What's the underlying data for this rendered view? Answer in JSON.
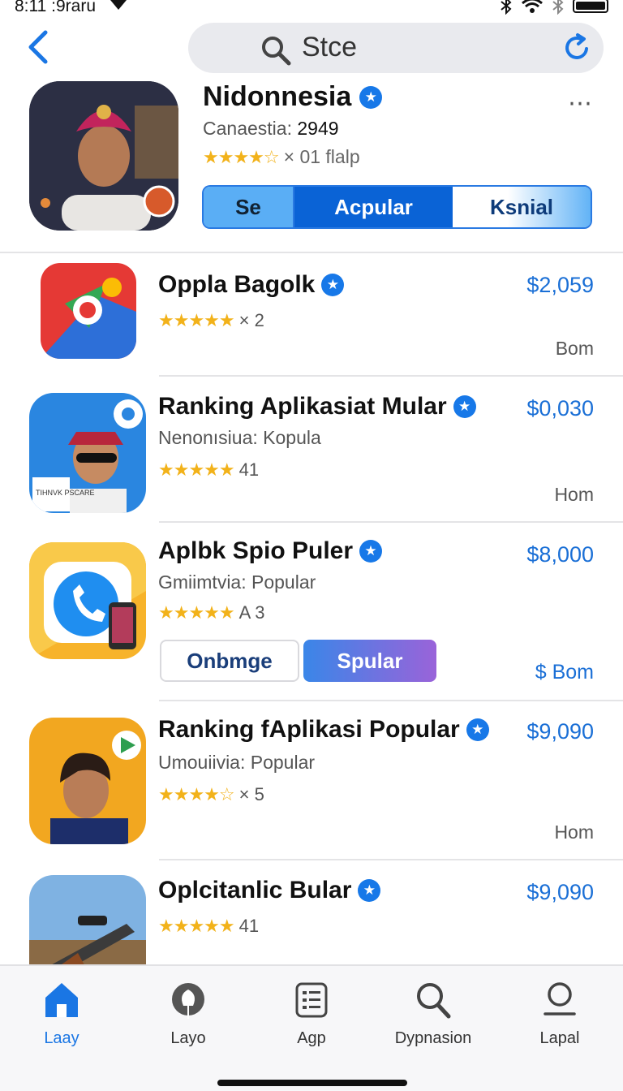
{
  "status": {
    "time": "8:11 :9raru"
  },
  "search": {
    "text": "Stce"
  },
  "featured": {
    "title": "Nidonnesia",
    "subtitle_label": "Canaestia:",
    "subtitle_value": "2949",
    "rating_text": "× 01 flalp",
    "segments": [
      "Se",
      "Acpular",
      "Ksnial"
    ]
  },
  "apps": [
    {
      "name": "Oppla Bagolk",
      "category": "",
      "rating": "× 2",
      "stars": 4.5,
      "price": "$2,059",
      "meta": "Bom"
    },
    {
      "name": "Ranking Aplikasiat Mular",
      "category": "Nenonısiua: Kopula",
      "rating": "41",
      "stars": 4.5,
      "price": "$0,030",
      "meta": "Hom",
      "icon_text": "TIHNVK PSCARE"
    },
    {
      "name": "Aplbk Spio Puler",
      "category": "Gmiimtvia: Popular",
      "rating": "A 3",
      "stars": 5,
      "price": "$8,000",
      "meta": "$ Bom",
      "buttons": [
        "Onbmge",
        "Spular"
      ]
    },
    {
      "name": "Ranking fAplikasi Popular",
      "category": "Umouiivia: Popular",
      "rating": "× 5",
      "stars": 4.5,
      "price": "$9,090",
      "meta": "Hom"
    },
    {
      "name": "Oplcitanlic Bular",
      "category": "",
      "rating": "41",
      "stars": 5,
      "price": "$9,090",
      "meta": ""
    }
  ],
  "tabs": [
    {
      "label": "Laay",
      "icon": "home-icon",
      "active": true
    },
    {
      "label": "Layo",
      "icon": "balloon-icon",
      "active": false
    },
    {
      "label": "Agp",
      "icon": "list-icon",
      "active": false
    },
    {
      "label": "Dypnasion",
      "icon": "search-icon",
      "active": false
    },
    {
      "label": "Lapal",
      "icon": "person-icon",
      "active": false
    }
  ],
  "colors": {
    "accent": "#1a76e4",
    "price": "#1a6fd6",
    "star": "#f2b21a"
  }
}
